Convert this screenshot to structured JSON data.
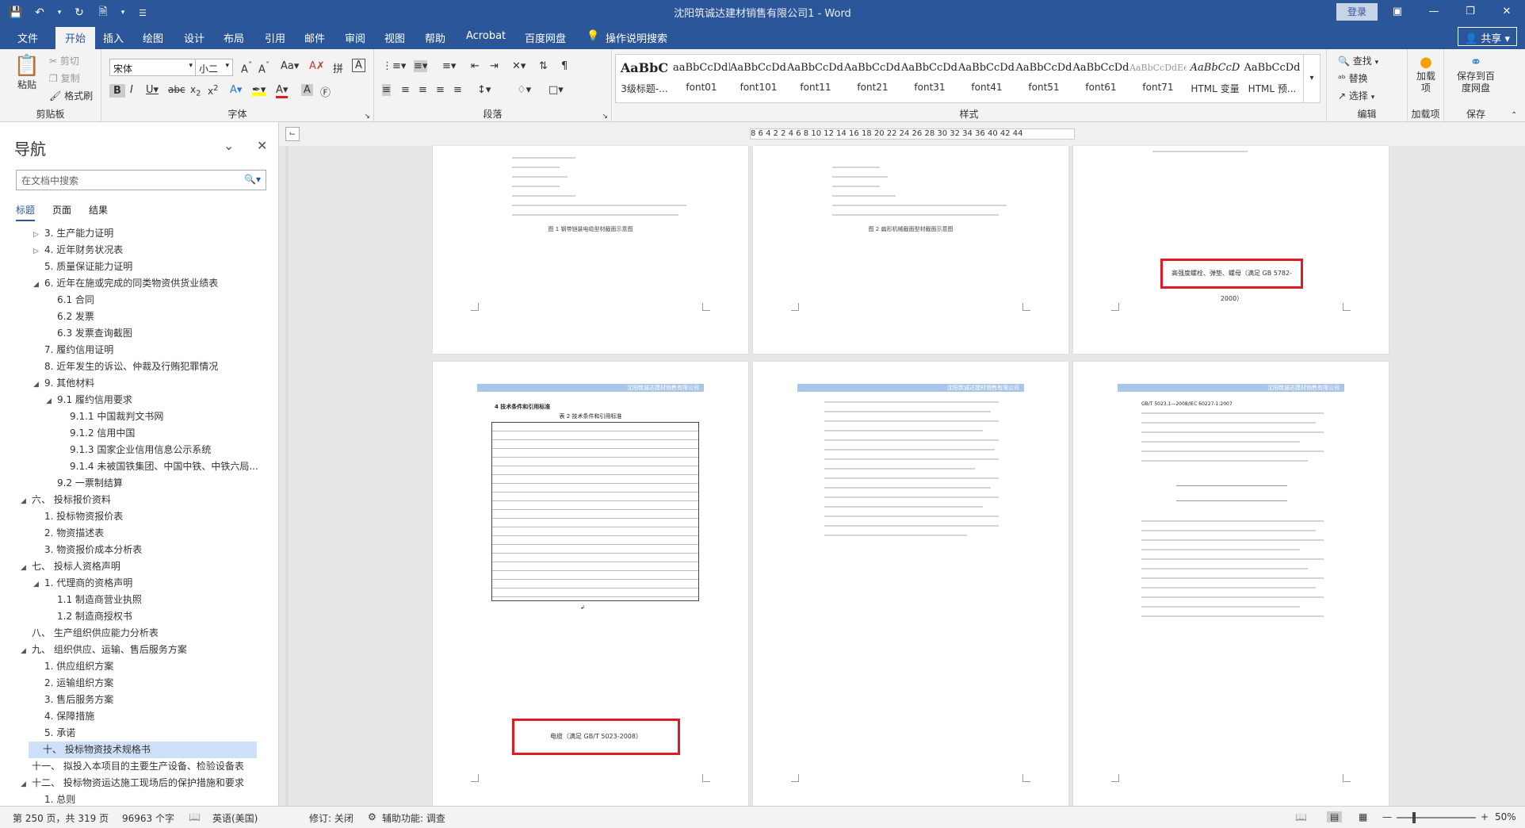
{
  "window": {
    "title": "沈阳筑诚达建材销售有限公司1 - Word",
    "login": "登录",
    "qat_icons": [
      "save-icon",
      "undo-icon",
      "redo-icon",
      "autosave-icon",
      "new-doc-icon",
      "more-icon"
    ]
  },
  "menu": {
    "items": [
      "文件",
      "开始",
      "插入",
      "绘图",
      "设计",
      "布局",
      "引用",
      "邮件",
      "审阅",
      "视图",
      "帮助",
      "Acrobat",
      "百度网盘"
    ],
    "tell_me": "操作说明搜索",
    "share": "共享"
  },
  "ribbon": {
    "clipboard": {
      "paste": "粘贴",
      "cut": "剪切",
      "copy": "复制",
      "format_painter": "格式刷",
      "label": "剪贴板"
    },
    "font": {
      "name": "宋体",
      "size": "小二",
      "label": "字体"
    },
    "paragraph": {
      "label": "段落"
    },
    "styles": {
      "label": "样式",
      "items": [
        {
          "preview": "AaBbC",
          "name": "3级标题-..."
        },
        {
          "preview": "aaBbCcDdI",
          "name": "font01"
        },
        {
          "preview": "AaBbCcDdI",
          "name": "font101"
        },
        {
          "preview": "AaBbCcDdI",
          "name": "font11"
        },
        {
          "preview": "AaBbCcDdI",
          "name": "font21"
        },
        {
          "preview": "AaBbCcDdI",
          "name": "font31"
        },
        {
          "preview": "AaBbCcDdI",
          "name": "font41"
        },
        {
          "preview": "AaBbCcDd",
          "name": "font51"
        },
        {
          "preview": "AaBbCcDd",
          "name": "font61"
        },
        {
          "preview": "AaBbCcDdEe",
          "name": "font71"
        },
        {
          "preview": "AaBbCcD",
          "name": "HTML 变量"
        },
        {
          "preview": "AaBbCcDd",
          "name": "HTML 预..."
        }
      ]
    },
    "editing": {
      "find": "查找",
      "replace": "替换",
      "select": "选择",
      "label": "编辑"
    },
    "addin": {
      "name": "加载项",
      "label": "加载项"
    },
    "save": {
      "name": "保存到百度网盘",
      "label": "保存"
    }
  },
  "nav": {
    "title": "导航",
    "search_placeholder": "在文档中搜索",
    "tabs": [
      "标题",
      "页面",
      "结果"
    ],
    "items": [
      {
        "text": "3. 生产能力证明",
        "level": 2,
        "arrow": "▷"
      },
      {
        "text": "4. 近年财务状况表",
        "level": 2,
        "arrow": "▷"
      },
      {
        "text": "5. 质量保证能力证明",
        "level": 2,
        "arrow": ""
      },
      {
        "text": "6. 近年在施或完成的同类物资供货业绩表",
        "level": 2,
        "arrow": "◢"
      },
      {
        "text": "6.1 合同",
        "level": 3,
        "arrow": ""
      },
      {
        "text": "6.2 发票",
        "level": 3,
        "arrow": ""
      },
      {
        "text": "6.3 发票查询截图",
        "level": 3,
        "arrow": ""
      },
      {
        "text": "7. 履约信用证明",
        "level": 2,
        "arrow": ""
      },
      {
        "text": "8. 近年发生的诉讼、仲裁及行贿犯罪情况",
        "level": 2,
        "arrow": ""
      },
      {
        "text": "9. 其他材料",
        "level": 2,
        "arrow": "◢"
      },
      {
        "text": "9.1 履约信用要求",
        "level": 3,
        "arrow": "◢"
      },
      {
        "text": "9.1.1 中国裁判文书网",
        "level": 4,
        "arrow": ""
      },
      {
        "text": "9.1.2 信用中国",
        "level": 4,
        "arrow": ""
      },
      {
        "text": "9.1.3 国家企业信用信息公示系统",
        "level": 4,
        "arrow": ""
      },
      {
        "text": "9.1.4 未被国铁集团、中国中铁、中铁六局...",
        "level": 4,
        "arrow": ""
      },
      {
        "text": "9.2 一票制结算",
        "level": 3,
        "arrow": ""
      },
      {
        "text": "六、 投标报价资料",
        "level": 1,
        "arrow": "◢"
      },
      {
        "text": "1. 投标物资报价表",
        "level": 2,
        "arrow": ""
      },
      {
        "text": "2. 物资描述表",
        "level": 2,
        "arrow": ""
      },
      {
        "text": "3. 物资报价成本分析表",
        "level": 2,
        "arrow": ""
      },
      {
        "text": "七、 投标人资格声明",
        "level": 1,
        "arrow": "◢"
      },
      {
        "text": "1. 代理商的资格声明",
        "level": 2,
        "arrow": "◢"
      },
      {
        "text": "1.1 制造商营业执照",
        "level": 3,
        "arrow": ""
      },
      {
        "text": "1.2 制造商授权书",
        "level": 3,
        "arrow": ""
      },
      {
        "text": "八、 生产组织供应能力分析表",
        "level": 1,
        "arrow": ""
      },
      {
        "text": "九、 组织供应、运输、售后服务方案",
        "level": 1,
        "arrow": "◢"
      },
      {
        "text": "1. 供应组织方案",
        "level": 2,
        "arrow": ""
      },
      {
        "text": "2. 运输组织方案",
        "level": 2,
        "arrow": ""
      },
      {
        "text": "3. 售后服务方案",
        "level": 2,
        "arrow": ""
      },
      {
        "text": "4. 保障措施",
        "level": 2,
        "arrow": ""
      },
      {
        "text": "5. 承诺",
        "level": 2,
        "arrow": ""
      },
      {
        "text": "十、 投标物资技术规格书",
        "level": 1,
        "arrow": "",
        "selected": true
      },
      {
        "text": "十一、 拟投入本项目的主要生产设备、检验设备表",
        "level": 1,
        "arrow": ""
      },
      {
        "text": "十二、 投标物资运达施工现场后的保护措施和要求",
        "level": 1,
        "arrow": "◢"
      },
      {
        "text": "1. 总则",
        "level": 2,
        "arrow": ""
      }
    ]
  },
  "ruler": {
    "ticks": "8  6  4  2     2  4  6  8  10 12 14 16 18 20 22 24 26 28 30 32 34 36    40 42 44"
  },
  "pages": {
    "header_company": "沈阳筑诚达建材销售有限公司",
    "top_right_box": "高强度螺栓、弹垫、螺母（满足 GB 5782-2000）",
    "bottom_left_box": "电缆（满足 GB/T 5023-2008）",
    "table_title": "表 2 技术条件和引用标准",
    "section_title": "4 技术条件和引用标准",
    "right_std": "GB/T 5023.1—2008/IEC 60227-1:2007",
    "caption1": "图 1 钢带铠装电缆型材截面示意图",
    "caption2": "图 2 扁形机械截面型材截面示意图"
  },
  "status": {
    "page": "第 250 页，共 319 页",
    "words": "96963 个字",
    "lang": "英语(美国)",
    "track": "修订: 关闭",
    "a11y": "辅助功能: 调查",
    "zoom": "50%"
  }
}
